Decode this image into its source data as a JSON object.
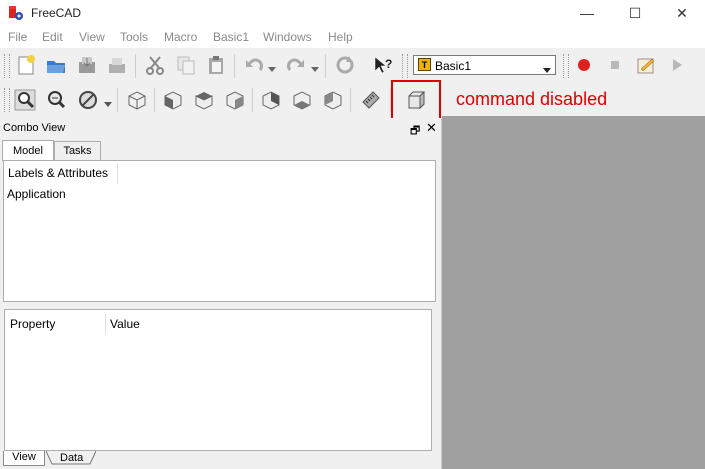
{
  "window": {
    "title": "FreeCAD",
    "minimize_glyph": "—",
    "maximize_glyph": "☐",
    "close_glyph": "✕"
  },
  "menu": [
    "File",
    "Edit",
    "View",
    "Tools",
    "Macro",
    "Basic1",
    "Windows",
    "Help"
  ],
  "workbench": {
    "label": "Basic1",
    "icon_letter": "T"
  },
  "combo": {
    "title": "Combo View",
    "tabs": [
      "Model",
      "Tasks"
    ],
    "tree_header": "Labels & Attributes",
    "tree_items": [
      "Application"
    ],
    "prop_headers": [
      "Property",
      "Value"
    ],
    "bottom_tabs": [
      "View",
      "Data"
    ]
  },
  "annotation": {
    "text": "command disabled",
    "color": "#e00000"
  },
  "icons": [
    "new-file-icon",
    "open-file-icon",
    "save-icon",
    "save-as-icon",
    "cut-icon",
    "copy-icon",
    "paste-icon",
    "undo-icon",
    "redo-icon",
    "refresh-icon",
    "whats-this-icon",
    "record-macro-icon",
    "stop-macro-icon",
    "edit-macro-icon",
    "run-macro-icon",
    "fit-all-icon",
    "fit-selection-icon",
    "draw-style-icon",
    "isometric-view-icon",
    "front-view-icon",
    "top-view-icon",
    "right-view-icon",
    "rear-view-icon",
    "bottom-view-icon",
    "left-view-icon",
    "measure-icon",
    "cube-command-icon"
  ]
}
